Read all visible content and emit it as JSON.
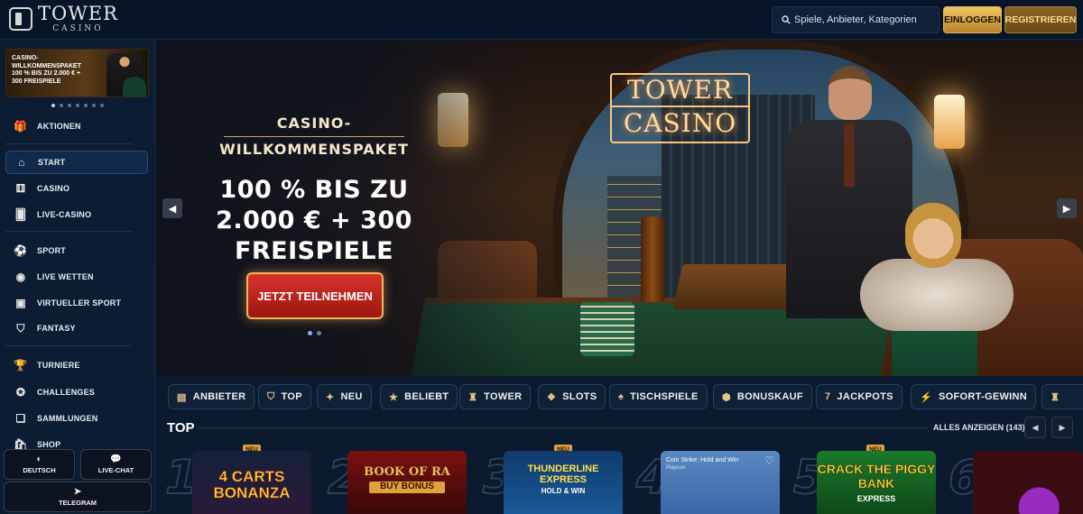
{
  "header": {
    "logo_main": "TOWER",
    "logo_sub": "CASINO",
    "search_placeholder": "Spiele, Anbieter, Kategorien",
    "login_label": "EINLOGGEN",
    "register_label": "REGISTRIEREN"
  },
  "sidebar": {
    "promo_text": "CASINO-WILLKOMMENSPAKET 100 % BIS ZU 2.000 € + 300 FREISPIELE",
    "items": [
      {
        "label": "AKTIONEN",
        "icon": "gift-icon"
      },
      {
        "label": "START",
        "icon": "home-icon"
      },
      {
        "label": "CASINO",
        "icon": "dice-icon"
      },
      {
        "label": "LIVE-CASINO",
        "icon": "cards-icon"
      },
      {
        "label": "SPORT",
        "icon": "ball-icon"
      },
      {
        "label": "LIVE WETTEN",
        "icon": "broadcast-icon"
      },
      {
        "label": "VIRTUELLER SPORT",
        "icon": "virtual-sport-icon"
      },
      {
        "label": "FANTASY",
        "icon": "shield-icon"
      },
      {
        "label": "TURNIERE",
        "icon": "trophy-icon"
      },
      {
        "label": "CHALLENGES",
        "icon": "medal-icon"
      },
      {
        "label": "SAMMLUNGEN",
        "icon": "collection-icon"
      },
      {
        "label": "SHOP",
        "icon": "shop-icon"
      }
    ],
    "lang_label": "DEUTSCH",
    "chat_label": "LIVE-CHAT",
    "telegram_label": "TELEGRAM"
  },
  "hero": {
    "sign_line1": "TOWER",
    "sign_line2": "CASINO",
    "kicker_line1": "CASINO-",
    "kicker_line2": "WILLKOMMENSPAKET",
    "headline_line1": "100 % BIS ZU",
    "headline_line2": "2.000 € + 300",
    "headline_line3": "FREISPIELE",
    "cta_label": "JETZT TEILNEHMEN"
  },
  "categories": [
    {
      "label": "ANBIETER",
      "icon": "provider-icon"
    },
    {
      "label": "TOP",
      "icon": "top-icon"
    },
    {
      "label": "NEU",
      "icon": "new-icon"
    },
    {
      "label": "BELIEBT",
      "icon": "star-icon"
    },
    {
      "label": "TOWER",
      "icon": "tower-icon"
    },
    {
      "label": "SLOTS",
      "icon": "slots-icon"
    },
    {
      "label": "TISCHSPIELE",
      "icon": "table-games-icon"
    },
    {
      "label": "BONUSKAUF",
      "icon": "bonus-buy-icon"
    },
    {
      "label": "JACKPOTS",
      "icon": "jackpot-icon"
    },
    {
      "label": "SOFORT-GEWINN",
      "icon": "instant-win-icon"
    }
  ],
  "top_section": {
    "title": "TOP",
    "show_all": "ALLES ANZEIGEN (143)",
    "games": [
      {
        "rank": "1",
        "title": "4 CARTS BONANZA",
        "badge": "NEU"
      },
      {
        "rank": "2",
        "title": "BOOK OF RA",
        "subtitle": "BUY BONUS",
        "badge": ""
      },
      {
        "rank": "3",
        "title": "THUNDERLINE EXPRESS",
        "subtitle": "HOLD & WIN",
        "badge": "NEU"
      },
      {
        "rank": "4",
        "title": "Coin Strike: Hold and Win",
        "provider": "Playson",
        "badge": ""
      },
      {
        "rank": "5",
        "title": "CRACK THE PIGGY BANK",
        "subtitle": "EXPRESS",
        "badge": "NEU"
      },
      {
        "rank": "6",
        "title": "",
        "badge": ""
      }
    ]
  },
  "colors": {
    "gold": "#f3c463",
    "background": "#0b1a2e",
    "cta_red": "#d9342b"
  }
}
